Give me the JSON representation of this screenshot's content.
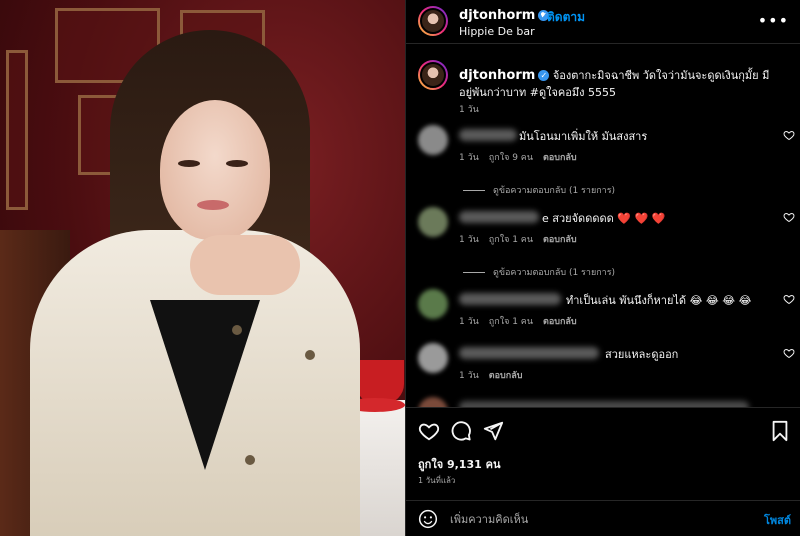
{
  "post": {
    "username": "djtonhorm",
    "follow_label": "ติดตาม",
    "location": "Hippie De bar",
    "more_icon": "more-options-icon"
  },
  "caption": {
    "text": "จ้องตากะมิจฉาชีพ วัดใจว่ามันจะดูดเงินกุมั้ย มีอยู่พันกว่าบาท #ดูใจคอมึง 5555",
    "time": "1 วัน"
  },
  "comments": [
    {
      "text": "มันโอนมาเพิ่มให้ มันสงสาร",
      "time": "1 วัน",
      "likes": "ถูกใจ 9 คน",
      "reply": "ตอบกลับ",
      "view_replies": "ดูข้อความตอบกลับ (1 รายการ)",
      "avatar_color": "#8a8a8a"
    },
    {
      "text": "e สวยจัดดดดด",
      "hearts": "❤️ ❤️ ❤️",
      "time": "1 วัน",
      "likes": "ถูกใจ 1 คน",
      "reply": "ตอบกลับ",
      "view_replies": "ดูข้อความตอบกลับ (1 รายการ)",
      "avatar_color": "#6b7a5a"
    },
    {
      "text": "ทำเป็นเล่น พันนึงก็หายได้ 😂 😂 😂 😂",
      "time": "1 วัน",
      "likes": "ถูกใจ 1 คน",
      "reply": "ตอบกลับ",
      "avatar_color": "#5a7a4a"
    },
    {
      "text": "สวยแหละดูออก",
      "time": "1 วัน",
      "reply": "ตอบกลับ",
      "avatar_color": "#9a9a9a"
    }
  ],
  "engagement": {
    "likes_label": "ถูกใจ 9,131 คน",
    "time_ago": "1 วันที่แล้ว"
  },
  "composer": {
    "placeholder": "เพิ่มความคิดเห็น",
    "post_label": "โพสต์"
  },
  "colors": {
    "accent": "#0095f6",
    "background": "#000000",
    "muted_text": "#a8a8a8"
  }
}
